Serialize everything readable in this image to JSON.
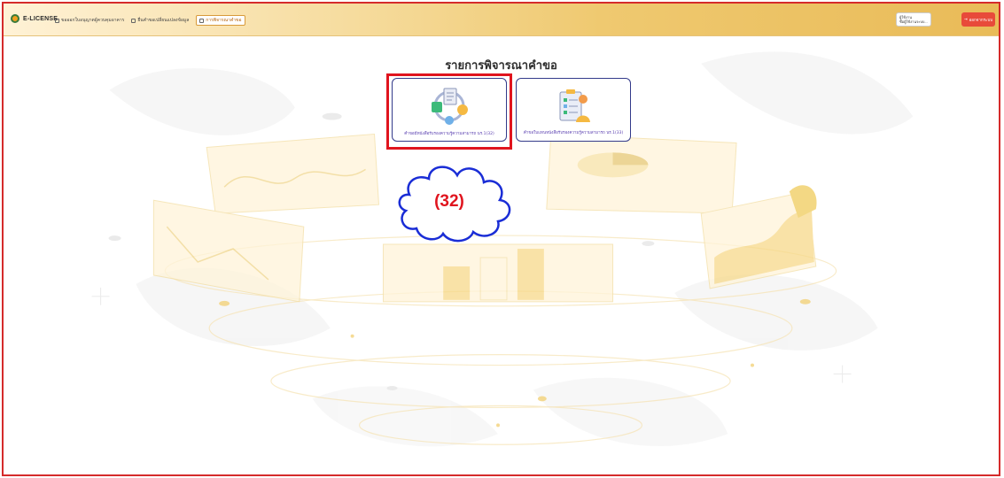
{
  "app": {
    "name": "E-LICENSE"
  },
  "nav": {
    "items": [
      {
        "label": "ขอออกใบอนุญาตผู้ควบคุมอาคาร"
      },
      {
        "label": "ยื่นคำขอเปลี่ยนแปลงข้อมูล"
      },
      {
        "label": "การพิจารณาคำขอ"
      }
    ]
  },
  "user": {
    "line1": "ผู้ใช้งาน",
    "line2": "ชื่อผู้ใช้งานระบบ..."
  },
  "header": {
    "logout_label": "ออกจากระบบ"
  },
  "page": {
    "title": "รายการพิจารณาคำขอ"
  },
  "cards": [
    {
      "label": "คำขอมีหนังสือรับรองความรู้ความสามารถ นร.1(32)",
      "icon": "workflow-icon"
    },
    {
      "label": "คำขอใบแทนหนังสือรับรองความรู้ความสามารถ นร.1(33)",
      "icon": "clipboard-icon"
    }
  ],
  "annotation": {
    "label": "(32)",
    "color": "#e0141e"
  },
  "colors": {
    "accent": "#e9bb58",
    "card_border": "#333a8a",
    "highlight": "#e0141e"
  }
}
